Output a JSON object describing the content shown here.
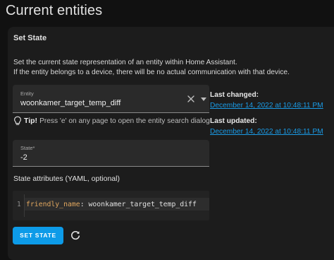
{
  "page": {
    "title": "Current entities"
  },
  "set_state": {
    "title": "Set State",
    "description_line1": "Set the current state representation of an entity within Home Assistant.",
    "description_line2": "If the entity belongs to a device, there will be no actual communication with that device.",
    "entity_field": {
      "label": "Entity",
      "value": "woonkamer_target_temp_diff"
    },
    "tip": {
      "strong": "Tip!",
      "text": "Press 'e' on any page to open the entity search dialog"
    },
    "state_field": {
      "label": "State*",
      "value": "-2"
    },
    "attributes_label": "State attributes (YAML, optional)",
    "code": {
      "line_number": "1",
      "key": "friendly_name",
      "separator": ":",
      "value": " woonkamer_target_temp_diff"
    },
    "set_state_button_label": "SET STATE",
    "last_changed": {
      "label": "Last changed:",
      "value": "December 14, 2022 at 10:48:11 PM"
    },
    "last_updated": {
      "label": "Last updated:",
      "value": "December 14, 2022 at 10:48:11 PM"
    }
  },
  "icons": {
    "clear": "close-icon",
    "dropdown": "caret-down-icon",
    "tip": "lightbulb-icon",
    "refresh": "refresh-icon"
  },
  "colors": {
    "background": "#111111",
    "card": "#1c1c1c",
    "accent": "#0d9be8",
    "link": "#1a9be6",
    "yaml_key": "#e0a65e"
  }
}
